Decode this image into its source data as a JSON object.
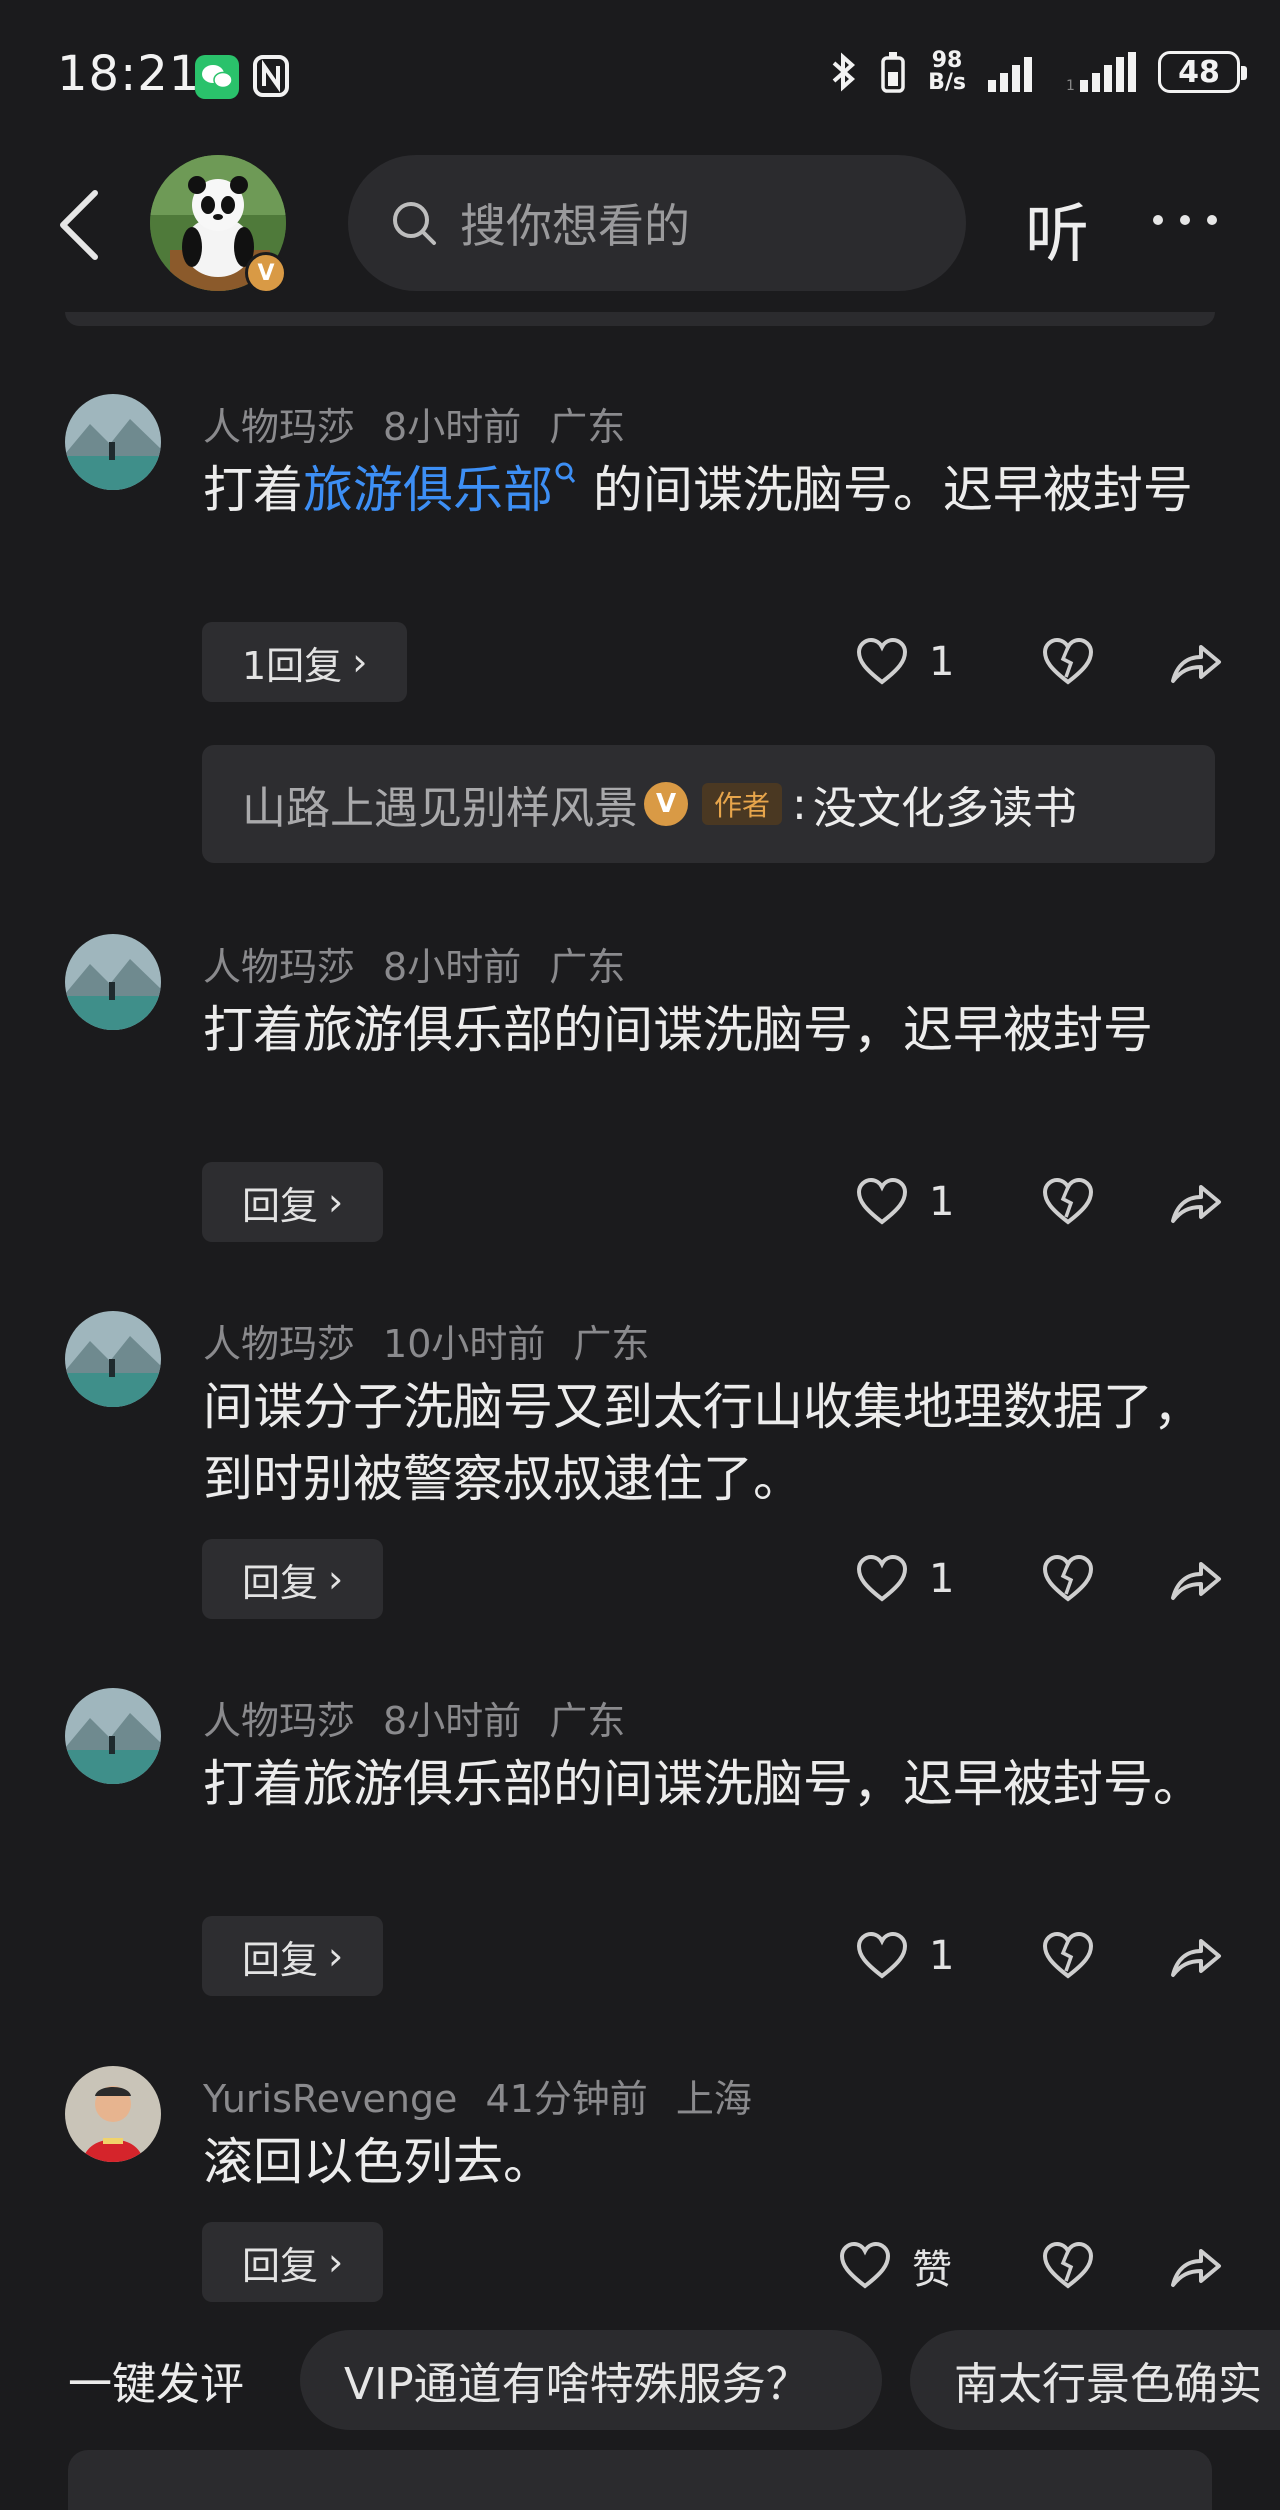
{
  "status": {
    "time": "18:21",
    "speed_value": "98",
    "speed_unit": "B/s",
    "battery": "48"
  },
  "header": {
    "search_placeholder": "搜你想看的",
    "listen_label": "听"
  },
  "comments": [
    {
      "user": "人物玛莎",
      "time": "8小时前",
      "location": "广东",
      "text_before": "打着",
      "text_link": "旅游俱乐部",
      "text_after": " 的间谍洗脑号。迟早被封号",
      "reply_label": "1回复",
      "likes": "1",
      "sub_reply": {
        "name": "山路上遇见别样风景",
        "badge": "V",
        "tag": "作者",
        "colon": ":",
        "text": "没文化多读书"
      }
    },
    {
      "user": "人物玛莎",
      "time": "8小时前",
      "location": "广东",
      "text": "打着旅游俱乐部的间谍洗脑号，迟早被封号",
      "reply_label": "回复",
      "likes": "1"
    },
    {
      "user": "人物玛莎",
      "time": "10小时前",
      "location": "广东",
      "text": "间谍分子洗脑号又到太行山收集地理数据了，到时别被警察叔叔逮住了。",
      "reply_label": "回复",
      "likes": "1"
    },
    {
      "user": "人物玛莎",
      "time": "8小时前",
      "location": "广东",
      "text": "打着旅游俱乐部的间谍洗脑号，迟早被封号。",
      "reply_label": "回复",
      "likes": "1"
    },
    {
      "user": "YurisRevenge",
      "time": "41分钟前",
      "location": "上海",
      "text": "滚回以色列去。",
      "reply_label": "回复",
      "likes": "赞"
    }
  ],
  "quick": {
    "label": "一键发评",
    "chips": [
      "VIP通道有啥特殊服务？",
      "南太行景色确实"
    ]
  },
  "colors": {
    "background": "#1b1b1d",
    "link": "#3d8ff5",
    "badge": "#d99a45",
    "wechat": "#2ac26b"
  },
  "icons": [
    "back-icon",
    "search-icon",
    "more-icon",
    "heart-icon",
    "broken-heart-icon",
    "share-icon",
    "chevron-right-icon"
  ]
}
